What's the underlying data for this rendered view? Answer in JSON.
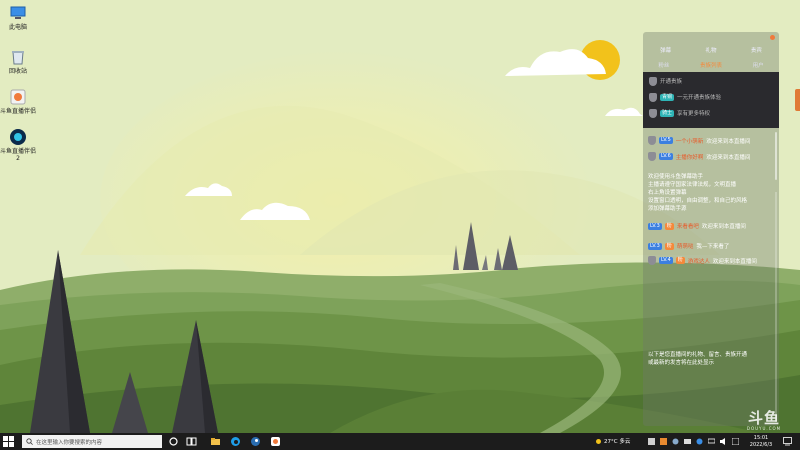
{
  "desktop": {
    "icons": [
      {
        "name": "this-pc-icon",
        "label": "此电脑"
      },
      {
        "name": "recycle-bin-icon",
        "label": "回收站"
      },
      {
        "name": "streaming-tool-icon",
        "label": "斗鱼直播伴侣"
      },
      {
        "name": "app-launcher-icon",
        "label": "斗鱼直播伴侣2"
      }
    ]
  },
  "chat": {
    "tabs": [
      "弹幕",
      "礼物",
      "贵宾"
    ],
    "subtabs": [
      "粉丝",
      "贵族列表",
      "用户"
    ],
    "noble_rows": [
      {
        "badge": "",
        "text": "开通贵族"
      },
      {
        "badge": "青铜",
        "text": "一元开通贵族体验"
      },
      {
        "badge": "骑士",
        "text": "享有更多特权"
      }
    ],
    "messages": [
      {
        "level": "LV.5",
        "name": "一个小萌新",
        "text": "欢迎来到本直播间"
      },
      {
        "level": "LV.6",
        "name": "主播你好啊",
        "text": "欢迎来到本直播间"
      }
    ],
    "system_lines": [
      "欢迎使用斗鱼弹幕助手",
      "主播请遵守国家法律法规，文明直播",
      "右上角设置弹幕",
      "设置窗口透明，自由调整，和自己的风格",
      "添加弹幕助手源"
    ],
    "messages2": [
      {
        "level": "LV.3",
        "fan": "粉",
        "name": "来看看吧",
        "text": "欢迎来到本直播间"
      },
      {
        "level": "LV.3",
        "fan": "粉",
        "name": "萌萌哒",
        "text": "我—下来看了"
      },
      {
        "level": "LV.4",
        "fan": "粉",
        "name": "游戏达人",
        "text": "欢迎来到本直播间"
      }
    ],
    "footer_lines": [
      "以下是您直播间的礼物、留言、贵族开通",
      "或最新的发言将在此处显示"
    ]
  },
  "watermark": {
    "big": "斗鱼",
    "small": "DOUYU.COM"
  },
  "taskbar": {
    "search_placeholder": "在这里输入你要搜索的内容",
    "weather": "27°C 多云",
    "clock_time": "15:01",
    "clock_date": "2022/6/3"
  }
}
